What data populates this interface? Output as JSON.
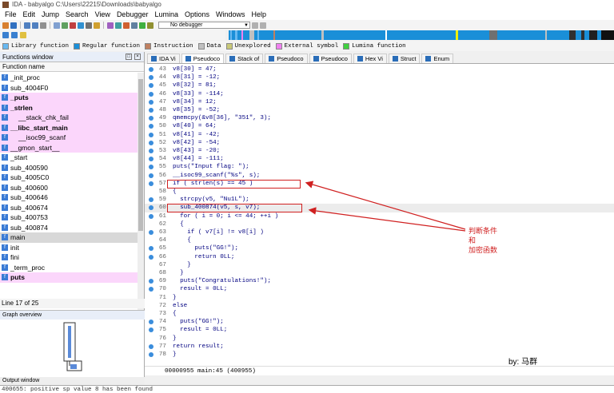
{
  "window": {
    "title": "IDA - babyalgo C:\\Users\\22215\\Downloads\\babyalgo"
  },
  "menu": [
    "File",
    "Edit",
    "Jump",
    "Search",
    "View",
    "Debugger",
    "Lumina",
    "Options",
    "Windows",
    "Help"
  ],
  "toolbar": {
    "debugger_select": "No debugger"
  },
  "legend": [
    {
      "label": "Library function",
      "color": "#68b8f0"
    },
    {
      "label": "Regular function",
      "color": "#1a8fd8"
    },
    {
      "label": "Instruction",
      "color": "#c08060"
    },
    {
      "label": "Data",
      "color": "#c0c0c0"
    },
    {
      "label": "Unexplored",
      "color": "#c8c878"
    },
    {
      "label": "External symbol",
      "color": "#f080f0"
    },
    {
      "label": "Lumina function",
      "color": "#40d040"
    }
  ],
  "functions_window": {
    "title": "Functions window",
    "column": "Function name",
    "items": [
      {
        "name": "_init_proc",
        "kind": "normal"
      },
      {
        "name": "sub_4004F0",
        "kind": "normal"
      },
      {
        "name": "_puts",
        "kind": "lib"
      },
      {
        "name": "_strlen",
        "kind": "lib"
      },
      {
        "name": "__stack_chk_fail",
        "kind": "lib"
      },
      {
        "name": "__libc_start_main",
        "kind": "lib"
      },
      {
        "name": "__isoc99_scanf",
        "kind": "lib"
      },
      {
        "name": "__gmon_start__",
        "kind": "lib"
      },
      {
        "name": "_start",
        "kind": "normal"
      },
      {
        "name": "sub_400590",
        "kind": "normal"
      },
      {
        "name": "sub_4005C0",
        "kind": "normal"
      },
      {
        "name": "sub_400600",
        "kind": "normal"
      },
      {
        "name": "sub_400646",
        "kind": "normal"
      },
      {
        "name": "sub_400674",
        "kind": "normal"
      },
      {
        "name": "sub_400753",
        "kind": "normal"
      },
      {
        "name": "sub_400874",
        "kind": "normal"
      },
      {
        "name": "main",
        "kind": "selected"
      },
      {
        "name": "init",
        "kind": "normal"
      },
      {
        "name": "fini",
        "kind": "normal"
      },
      {
        "name": "_term_proc",
        "kind": "normal"
      },
      {
        "name": "puts",
        "kind": "lib"
      }
    ]
  },
  "line_status": "Line 17 of 25",
  "graph_overview": {
    "title": "Graph overview"
  },
  "output_window": {
    "title": "Output window",
    "last_message": "400655: positive sp value 8 has been found"
  },
  "tabs": [
    {
      "label": "IDA Vi"
    },
    {
      "label": "Pseudoco"
    },
    {
      "label": "Stack of"
    },
    {
      "label": "Pseudoco"
    },
    {
      "label": "Pseudoco"
    },
    {
      "label": "Hex Vi"
    },
    {
      "label": "Struct"
    },
    {
      "label": "Enum"
    }
  ],
  "code": [
    {
      "ln": "43",
      "text": "v8[30] = 47;",
      "dot": true
    },
    {
      "ln": "44",
      "text": "v8[31] = -12;",
      "dot": true
    },
    {
      "ln": "45",
      "text": "v8[32] = 81;",
      "dot": true
    },
    {
      "ln": "46",
      "text": "v8[33] = -114;",
      "dot": true
    },
    {
      "ln": "47",
      "text": "v8[34] = 12;",
      "dot": true
    },
    {
      "ln": "48",
      "text": "v8[35] = -52;",
      "dot": true
    },
    {
      "ln": "49",
      "text": "qmemcpy(&v8[36], \"351\", 3);",
      "dot": true
    },
    {
      "ln": "50",
      "text": "v8[40] = 64;",
      "dot": true
    },
    {
      "ln": "51",
      "text": "v8[41] = -42;",
      "dot": true
    },
    {
      "ln": "52",
      "text": "v8[42] = -54;",
      "dot": true
    },
    {
      "ln": "53",
      "text": "v8[43] = -20;",
      "dot": true
    },
    {
      "ln": "54",
      "text": "v8[44] = -111;",
      "dot": true
    },
    {
      "ln": "55",
      "text": "puts(\"Input flag: \");",
      "dot": true
    },
    {
      "ln": "56",
      "text": "__isoc99_scanf(\"%s\", s);",
      "dot": true
    },
    {
      "ln": "57",
      "text": "if ( strlen(s) == 45 )",
      "dot": true
    },
    {
      "ln": "58",
      "text": "{",
      "dot": false
    },
    {
      "ln": "59",
      "text": "  strcpy(v5, \"Nu1L\");",
      "dot": true
    },
    {
      "ln": "60",
      "text": "  sub_400874(v5, s, v7);",
      "dot": true
    },
    {
      "ln": "61",
      "text": "  for ( i = 0; i <= 44; ++i )",
      "dot": true
    },
    {
      "ln": "62",
      "text": "  {",
      "dot": false
    },
    {
      "ln": "63",
      "text": "    if ( v7[i] != v8[i] )",
      "dot": true
    },
    {
      "ln": "64",
      "text": "    {",
      "dot": false
    },
    {
      "ln": "65",
      "text": "      puts(\"GG!\");",
      "dot": true
    },
    {
      "ln": "66",
      "text": "      return 0LL;",
      "dot": true
    },
    {
      "ln": "67",
      "text": "    }",
      "dot": false
    },
    {
      "ln": "68",
      "text": "  }",
      "dot": false
    },
    {
      "ln": "69",
      "text": "  puts(\"Congratulations!\");",
      "dot": true
    },
    {
      "ln": "70",
      "text": "  result = 0LL;",
      "dot": true
    },
    {
      "ln": "71",
      "text": "}",
      "dot": false
    },
    {
      "ln": "72",
      "text": "else",
      "dot": false
    },
    {
      "ln": "73",
      "text": "{",
      "dot": false
    },
    {
      "ln": "74",
      "text": "  puts(\"GG!\");",
      "dot": true
    },
    {
      "ln": "75",
      "text": "  result = 0LL;",
      "dot": true
    },
    {
      "ln": "76",
      "text": "}",
      "dot": false
    },
    {
      "ln": "77",
      "text": "return result;",
      "dot": true
    },
    {
      "ln": "78",
      "text": "}",
      "dot": true
    }
  ],
  "code_status": "00000955 main:45 (400955)",
  "annotation": {
    "lines": [
      "判断条件",
      "和",
      "加密函数"
    ]
  },
  "author": "by: 马群"
}
